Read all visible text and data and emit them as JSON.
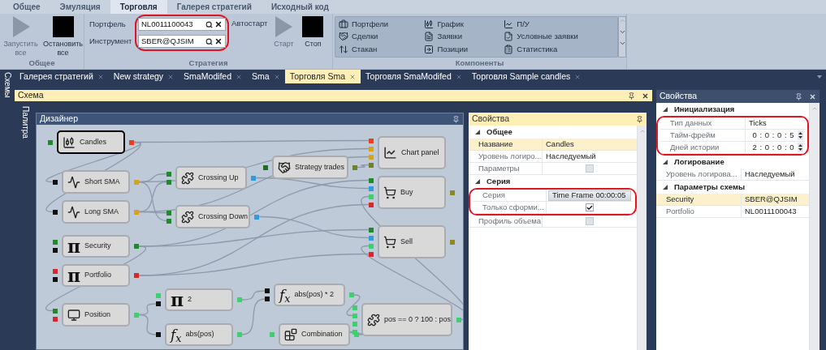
{
  "ribbon": {
    "tabs": [
      {
        "label": "Общее",
        "selected": false
      },
      {
        "label": "Эмуляция",
        "selected": false
      },
      {
        "label": "Торговля",
        "selected": true
      },
      {
        "label": "Галерея стратегий",
        "selected": false
      },
      {
        "label": "Исходный код",
        "selected": false
      }
    ],
    "general": {
      "title": "Общее",
      "buttons": [
        {
          "kind": "start",
          "label": "Запустить все",
          "disabled": true
        },
        {
          "kind": "stop",
          "label": "Остановить все",
          "disabled": false
        }
      ]
    },
    "strategy": {
      "title": "Стратегия",
      "fields": [
        {
          "label": "Портфель",
          "value": "NL0011100043"
        },
        {
          "label": "Инструмент",
          "value": "SBER@QJSIM"
        }
      ],
      "autostart": "Автостарт",
      "buttons": [
        {
          "kind": "start",
          "label": "Старт",
          "disabled": true
        },
        {
          "kind": "stop",
          "label": "Стоп",
          "disabled": false
        }
      ]
    },
    "components": {
      "title": "Компоненты",
      "items": [
        "Портфели",
        "Сделки",
        "Стакан",
        "График",
        "Заявки",
        "Позиции",
        "П/У",
        "Условные заявки",
        "Статистика"
      ]
    }
  },
  "side_tab": "Схемы",
  "document_tabs": [
    {
      "label": "Галерея стратегий",
      "selected": false
    },
    {
      "label": "New strategy",
      "selected": false
    },
    {
      "label": "SmaModifed",
      "selected": false
    },
    {
      "label": "Sma",
      "selected": false
    },
    {
      "label": "Торговля Sma",
      "selected": true
    },
    {
      "label": "Торговля SmaModifed",
      "selected": false
    },
    {
      "label": "Торговля Sample candles",
      "selected": false
    }
  ],
  "schema": {
    "title": "Схема",
    "palette": "Палитра",
    "designer": {
      "title": "Дизайнер",
      "nodes": [
        {
          "kind": "candles",
          "label": "Candles",
          "selected": true,
          "inputs": [
            {
              "color": "#1e8a2a"
            }
          ],
          "outputs": [
            {
              "color": "#e8401c"
            }
          ]
        },
        {
          "kind": "indicator",
          "label": "Short SMA",
          "selected": false,
          "inputs": [
            {
              "color": "#111111"
            }
          ],
          "outputs": [
            {
              "color": "#d9a21b"
            }
          ]
        },
        {
          "kind": "indicator",
          "label": "Long SMA",
          "selected": false,
          "inputs": [
            {
              "color": "#111111"
            }
          ],
          "outputs": [
            {
              "color": "#d9a21b"
            }
          ]
        },
        {
          "kind": "crossing",
          "label": "Crossing Up",
          "selected": false,
          "inputs": [
            {
              "color": "#1e8a2a"
            },
            {
              "color": "#1e8a2a"
            }
          ],
          "outputs": [
            {
              "color": "#2f9be3"
            }
          ]
        },
        {
          "kind": "crossing",
          "label": "Crossing Down",
          "selected": false,
          "inputs": [
            {
              "color": "#1e8a2a"
            },
            {
              "color": "#1e8a2a"
            }
          ],
          "outputs": [
            {
              "color": "#2f9be3"
            }
          ]
        },
        {
          "kind": "trades",
          "label": "Strategy trades",
          "selected": false,
          "inputs": [
            {
              "color": "#1e6e22"
            }
          ],
          "outputs": [
            {
              "color": "#6f7f2a"
            }
          ]
        },
        {
          "kind": "chart",
          "label": "Chart panel",
          "selected": false,
          "inputs": [
            {
              "color": "#e8401c"
            },
            {
              "color": "#d9a21b"
            },
            {
              "color": "#d9a21b"
            },
            {
              "color": "#6f7f2a"
            }
          ]
        },
        {
          "kind": "order",
          "label": "Buy",
          "selected": false,
          "inputs": [
            {
              "color": "#1e8a2a"
            },
            {
              "color": "#2f9be3"
            },
            {
              "color": "#3fcf6e"
            },
            {
              "color": "#d8282a"
            }
          ],
          "outputs": [
            {
              "color": "#8a8a22"
            }
          ]
        },
        {
          "kind": "order",
          "label": "Sell",
          "selected": false,
          "inputs": [
            {
              "color": "#1e8a2a"
            },
            {
              "color": "#2f9be3"
            },
            {
              "color": "#3fcf6e"
            },
            {
              "color": "#d8282a"
            }
          ],
          "outputs": [
            {
              "color": "#8a8a22"
            }
          ]
        },
        {
          "kind": "constant",
          "symbol": "π",
          "label": "Security",
          "selected": false,
          "inputs": [
            {
              "color": "#1e8a2a"
            },
            {
              "color": "#111111"
            }
          ],
          "outputs": [
            {
              "color": "#1e8a2a"
            }
          ]
        },
        {
          "kind": "constant",
          "symbol": "π",
          "label": "Portfolio",
          "selected": false,
          "inputs": [
            {
              "color": "#d8282a"
            },
            {
              "color": "#111111"
            }
          ],
          "outputs": [
            {
              "color": "#d8282a"
            }
          ]
        },
        {
          "kind": "position",
          "label": "Position",
          "selected": false,
          "inputs": [
            {
              "color": "#1e8a2a"
            },
            {
              "color": "#d8282a"
            }
          ],
          "outputs": [
            {
              "color": "#3fcf6e"
            }
          ]
        },
        {
          "kind": "constant",
          "symbol": "π",
          "label": "2",
          "selected": false,
          "inputs": [
            {
              "color": "#3fcf6e"
            },
            {
              "color": "#111111"
            }
          ],
          "outputs": [
            {
              "color": "#3fcf6e"
            }
          ]
        },
        {
          "kind": "formula",
          "symbol": "f$_{x}$",
          "label": "abs(pos)",
          "selected": false,
          "inputs": [
            {
              "color": "#111111"
            }
          ],
          "outputs": [
            {
              "color": "#3fcf6e"
            }
          ]
        },
        {
          "kind": "formula",
          "symbol": "f$_{x}$",
          "label": "abs(pos) * 2",
          "selected": false,
          "inputs": [
            {
              "color": "#111111"
            },
            {
              "color": "#111111"
            }
          ],
          "outputs": [
            {
              "color": "#3fcf6e"
            }
          ]
        },
        {
          "kind": "combination",
          "label": "Combination",
          "selected": false,
          "inputs": [
            {
              "color": "#3fcf6e"
            }
          ],
          "outputs": [
            {
              "color": "#3fcf6e"
            }
          ]
        },
        {
          "kind": "crossing",
          "label": "pos == 0 ? 100 : pos",
          "selected": false,
          "inputs": [
            {
              "color": "#3fcf6e"
            },
            {
              "color": "#3fcf6e"
            },
            {
              "color": "#3fcf6e"
            },
            {
              "color": "#3fcf6e"
            }
          ],
          "outputs": [
            {
              "color": "#3fcf6e"
            }
          ]
        }
      ]
    },
    "properties": {
      "title": "Свойства",
      "categories": [
        {
          "name": "Общее",
          "rows": [
            {
              "kind": "text",
              "label": "Название",
              "value": "Candles",
              "selected": true
            },
            {
              "kind": "text",
              "label": "Уровень логиро...",
              "value": "Наследуемый",
              "selected": false
            },
            {
              "kind": "checkbox",
              "label": "Параметры",
              "checked": false,
              "disabled": true,
              "selected": false
            }
          ]
        },
        {
          "name": "Серия",
          "rows": [
            {
              "kind": "dropdown",
              "label": "Серия",
              "value": "Time Frame 00:00:05",
              "selected": false
            },
            {
              "kind": "checkbox",
              "label": "Только сформи...",
              "checked": true,
              "disabled": false,
              "selected": false
            },
            {
              "kind": "checkbox",
              "label": "Профиль объема",
              "checked": false,
              "disabled": true,
              "selected": false
            }
          ]
        }
      ]
    }
  },
  "properties_panel": {
    "title": "Свойства",
    "categories": [
      {
        "name": "Инициализация",
        "rows": [
          {
            "kind": "text",
            "label": "Тип данных",
            "value": "Ticks",
            "selected": false
          },
          {
            "kind": "spin",
            "label": "Тайм-фрейм",
            "value": "0 : 0 : 0 : 5",
            "selected": false
          },
          {
            "kind": "spin",
            "label": "Дней истории",
            "value": "2 : 0 : 0 : 0",
            "selected": false
          }
        ]
      },
      {
        "name": "Логирование",
        "rows": [
          {
            "kind": "text",
            "label": "Уровень логирова...",
            "value": "Наследуемый",
            "selected": false
          }
        ]
      },
      {
        "name": "Параметры схемы",
        "rows": [
          {
            "kind": "text",
            "label": "Security",
            "value": "SBER@QJSIM",
            "selected": true
          },
          {
            "kind": "text",
            "label": "Portfolio",
            "value": "NL0011100043",
            "selected": false
          }
        ]
      }
    ]
  }
}
